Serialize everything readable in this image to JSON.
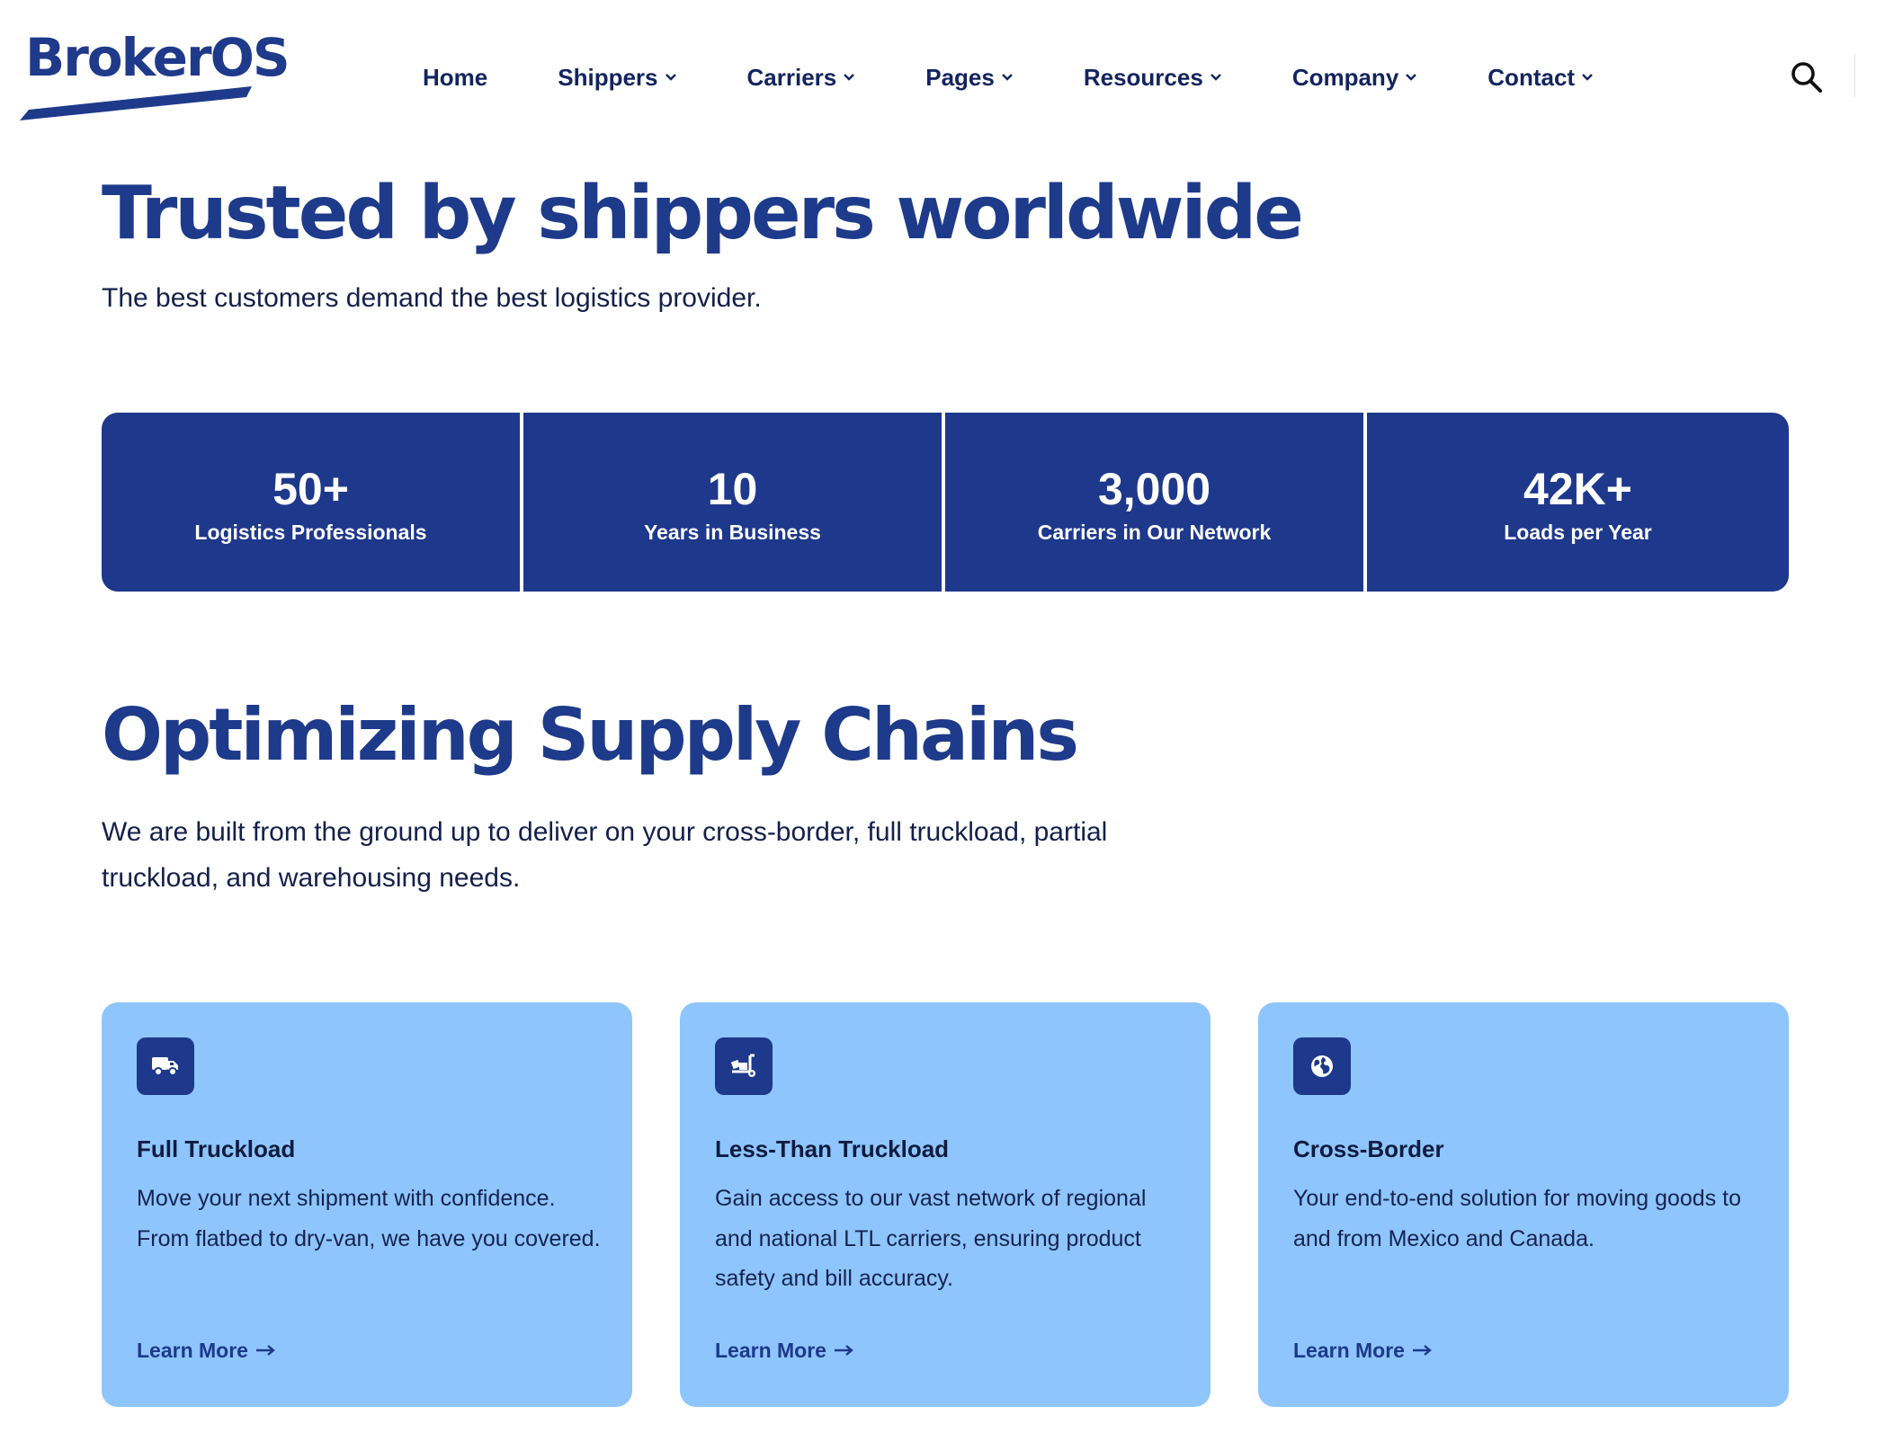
{
  "brand": {
    "logo_text": "BrokerOS",
    "primary_color": "#1e388b",
    "card_color": "#8ec5fd"
  },
  "nav": {
    "items": [
      {
        "label": "Home",
        "has_dropdown": false
      },
      {
        "label": "Shippers",
        "has_dropdown": true
      },
      {
        "label": "Carriers",
        "has_dropdown": true
      },
      {
        "label": "Pages",
        "has_dropdown": true
      },
      {
        "label": "Resources",
        "has_dropdown": true
      },
      {
        "label": "Company",
        "has_dropdown": true
      },
      {
        "label": "Contact",
        "has_dropdown": true
      }
    ],
    "search_icon": "search-icon"
  },
  "hero": {
    "title": "Trusted by shippers worldwide",
    "subtitle": "The best customers demand the best logistics provider."
  },
  "stats": [
    {
      "value": "50+",
      "label": "Logistics Professionals"
    },
    {
      "value": "10",
      "label": "Years in Business"
    },
    {
      "value": "3,000",
      "label": "Carriers in Our Network"
    },
    {
      "value": "42K+",
      "label": "Loads per Year"
    }
  ],
  "section": {
    "title": "Optimizing Supply Chains",
    "description": "We are built from the ground up to deliver on your cross-border, full truckload, partial truckload, and warehousing needs."
  },
  "cards": [
    {
      "icon": "truck-icon",
      "title": "Full Truckload",
      "description": "Move your next shipment with confidence. From flatbed to dry-van, we have you covered.",
      "link_label": "Learn More"
    },
    {
      "icon": "dolly-icon",
      "title": "Less-Than Truckload",
      "description": "Gain access to our vast network of regional and national LTL carriers, ensuring product safety and bill accuracy.",
      "link_label": "Learn More"
    },
    {
      "icon": "globe-icon",
      "title": "Cross-Border",
      "description": "Your end-to-end solution for moving goods to and from Mexico and Canada.",
      "link_label": "Learn More"
    }
  ]
}
